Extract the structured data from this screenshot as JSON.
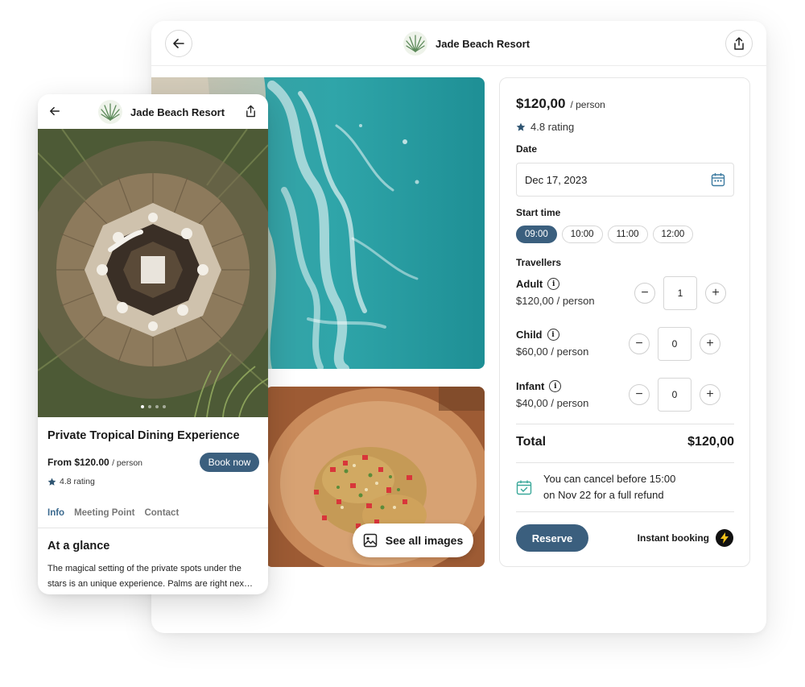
{
  "desktop": {
    "header": {
      "brand": "Jade Beach Resort",
      "back_icon": "arrow-left-icon",
      "share_icon": "share-icon"
    },
    "see_all_images": "See all images",
    "booking": {
      "price": "$120,00",
      "price_unit": "/ person",
      "rating": "4.8 rating",
      "date_label": "Date",
      "date_value": "Dec 17, 2023",
      "start_time_label": "Start time",
      "times": [
        "09:00",
        "10:00",
        "11:00",
        "12:00"
      ],
      "selected_time": "09:00",
      "travellers_label": "Travellers",
      "travellers": [
        {
          "name": "Adult",
          "price": "$120,00 / person",
          "count": "1"
        },
        {
          "name": "Child",
          "price": "$60,00 / person",
          "count": "0"
        },
        {
          "name": "Infant",
          "price": "$40,00 / person",
          "count": "0"
        }
      ],
      "total_label": "Total",
      "total_value": "$120,00",
      "cancel_line1": "You can cancel before 15:00",
      "cancel_line2": "on Nov 22 for a full refund",
      "reserve": "Reserve",
      "instant": "Instant booking"
    }
  },
  "mobile": {
    "header": {
      "brand": "Jade Beach Resort"
    },
    "title": "Private Tropical Dining Experience",
    "price_prefix": "From $120.00",
    "price_unit": "/ person",
    "book": "Book now",
    "rating": "4.8 rating",
    "tabs": [
      "Info",
      "Meeting Point",
      "Contact"
    ],
    "active_tab": "Info",
    "section_title": "At a glance",
    "body_line1": "The magical setting of the private spots under the",
    "body_line2": "stars is an unique experience. Palms are right nex…"
  },
  "colors": {
    "accent": "#3b5f7e",
    "tab_active": "#3b6a8f",
    "star": "#2f5572"
  }
}
